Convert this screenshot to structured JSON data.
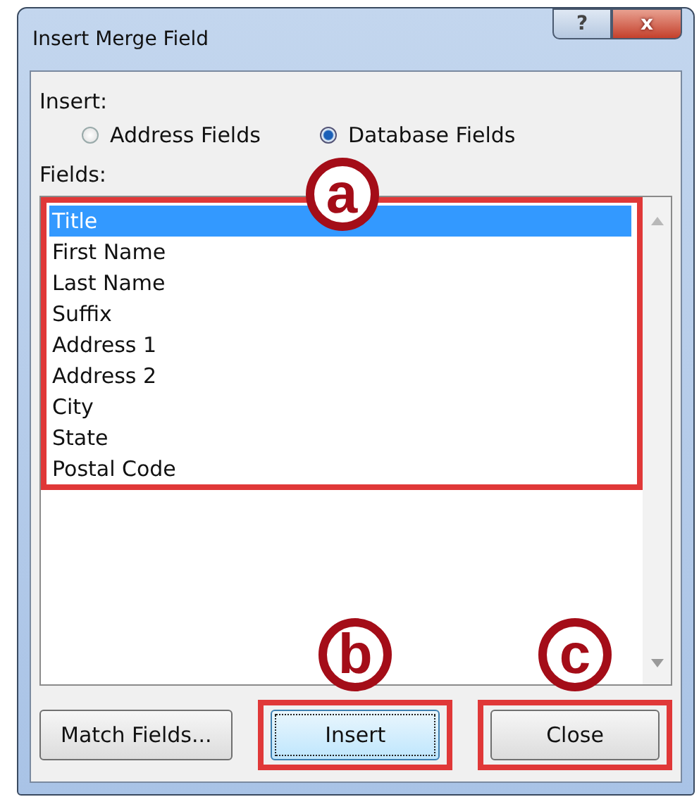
{
  "window": {
    "title": "Insert Merge Field",
    "title_buttons": [
      {
        "kind": "help",
        "label": "?"
      },
      {
        "kind": "close",
        "label": "x"
      }
    ]
  },
  "insert": {
    "label": "Insert:",
    "options": [
      {
        "label": "Address Fields",
        "selected": false
      },
      {
        "label": "Database Fields",
        "selected": true
      }
    ]
  },
  "fields": {
    "label": "Fields:",
    "callout": "a",
    "items": [
      {
        "label": "Title",
        "selected": true
      },
      {
        "label": "First Name",
        "selected": false
      },
      {
        "label": "Last Name",
        "selected": false
      },
      {
        "label": "Suffix",
        "selected": false
      },
      {
        "label": "Address 1",
        "selected": false
      },
      {
        "label": "Address 2",
        "selected": false
      },
      {
        "label": "City",
        "selected": false
      },
      {
        "label": "State",
        "selected": false
      },
      {
        "label": "Postal Code",
        "selected": false
      }
    ]
  },
  "buttons": [
    {
      "label": "Match Fields...",
      "focused": false
    },
    {
      "label": "Insert",
      "focused": true,
      "callout": "b"
    },
    {
      "label": "Close",
      "focused": false,
      "callout": "c"
    }
  ]
}
